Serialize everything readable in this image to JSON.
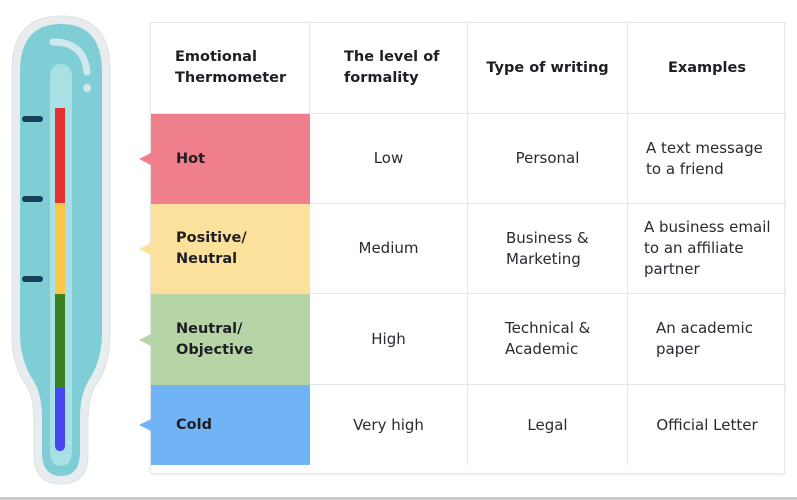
{
  "colors": {
    "hot": "#f07f8c",
    "positive": "#fbe19c",
    "neutral": "#b5d5a7",
    "cold": "#70b4f6",
    "thermo_red": "#e3312f",
    "thermo_yellow": "#fbc64a",
    "thermo_green": "#3b7f1f",
    "thermo_blue": "#4646f2",
    "thermo_body": "#7fced6",
    "thermo_shell": "#e8ecef",
    "tick": "#193f5a"
  },
  "table": {
    "headers": [
      "Emotional\nThermometer",
      "The level of\nformality",
      "Type of writing",
      "Examples"
    ],
    "rows": [
      {
        "label": "Hot",
        "formality": "Low",
        "writing_type": "Personal",
        "example": "A text message\nto a friend"
      },
      {
        "label": "Positive/\nNeutral",
        "formality": "Medium",
        "writing_type": "Business &\nMarketing",
        "example": "A business email\nto an affiliate\npartner"
      },
      {
        "label": "Neutral/\nObjective",
        "formality": "High",
        "writing_type": "Technical &\nAcademic",
        "example": "An academic\npaper"
      },
      {
        "label": "Cold",
        "formality": "Very high",
        "writing_type": "Legal",
        "example": "Official Letter"
      }
    ]
  }
}
